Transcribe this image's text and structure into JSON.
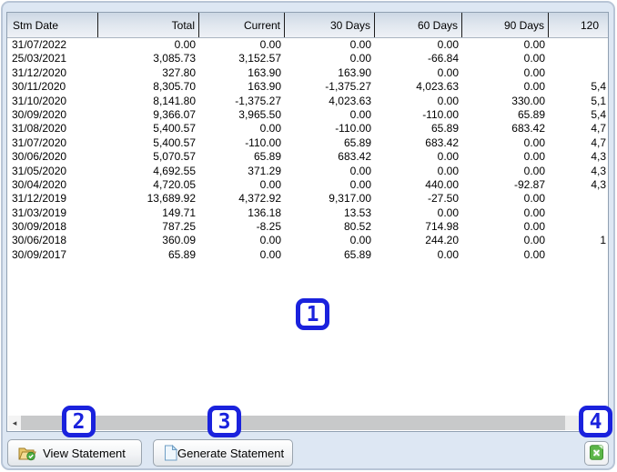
{
  "table": {
    "columns": [
      {
        "label": "Stm Date"
      },
      {
        "label": "Total"
      },
      {
        "label": "Current"
      },
      {
        "label": "30 Days"
      },
      {
        "label": "60 Days"
      },
      {
        "label": "90 Days"
      },
      {
        "label": "120"
      }
    ],
    "rows": [
      [
        "31/07/2022",
        "0.00",
        "0.00",
        "0.00",
        "0.00",
        "0.00",
        ""
      ],
      [
        "25/03/2021",
        "3,085.73",
        "3,152.57",
        "0.00",
        "-66.84",
        "0.00",
        ""
      ],
      [
        "31/12/2020",
        "327.80",
        "163.90",
        "163.90",
        "0.00",
        "0.00",
        ""
      ],
      [
        "30/11/2020",
        "8,305.70",
        "163.90",
        "-1,375.27",
        "4,023.63",
        "0.00",
        "5,4"
      ],
      [
        "31/10/2020",
        "8,141.80",
        "-1,375.27",
        "4,023.63",
        "0.00",
        "330.00",
        "5,1"
      ],
      [
        "30/09/2020",
        "9,366.07",
        "3,965.50",
        "0.00",
        "-110.00",
        "65.89",
        "5,4"
      ],
      [
        "31/08/2020",
        "5,400.57",
        "0.00",
        "-110.00",
        "65.89",
        "683.42",
        "4,7"
      ],
      [
        "31/07/2020",
        "5,400.57",
        "-110.00",
        "65.89",
        "683.42",
        "0.00",
        "4,7"
      ],
      [
        "30/06/2020",
        "5,070.57",
        "65.89",
        "683.42",
        "0.00",
        "0.00",
        "4,3"
      ],
      [
        "31/05/2020",
        "4,692.55",
        "371.29",
        "0.00",
        "0.00",
        "0.00",
        "4,3"
      ],
      [
        "30/04/2020",
        "4,720.05",
        "0.00",
        "0.00",
        "440.00",
        "-92.87",
        "4,3"
      ],
      [
        "31/12/2019",
        "13,689.92",
        "4,372.92",
        "9,317.00",
        "-27.50",
        "0.00",
        ""
      ],
      [
        "31/03/2019",
        "149.71",
        "136.18",
        "13.53",
        "0.00",
        "0.00",
        ""
      ],
      [
        "30/09/2018",
        "787.25",
        "-8.25",
        "80.52",
        "714.98",
        "0.00",
        ""
      ],
      [
        "30/06/2018",
        "360.09",
        "0.00",
        "0.00",
        "244.20",
        "0.00",
        "1"
      ],
      [
        "30/09/2017",
        "65.89",
        "0.00",
        "65.89",
        "0.00",
        "0.00",
        ""
      ]
    ]
  },
  "buttons": {
    "view_label": "View Statement",
    "generate_label": "Generate Statement"
  },
  "icons": {
    "scroll_left_glyph": "◂",
    "scroll_right_glyph": "▸"
  },
  "annotations": [
    {
      "label": "1"
    },
    {
      "label": "2"
    },
    {
      "label": "3"
    },
    {
      "label": "4"
    }
  ],
  "colors": {
    "annotation_blue": "#1a22dd",
    "excel_green": "#5cb648",
    "panel_background": "#dde7f3",
    "header_gradient_top": "#ccd7e4",
    "header_gradient_bottom": "#eef1f6",
    "scrollbar_thumb": "#c8c9ca"
  }
}
